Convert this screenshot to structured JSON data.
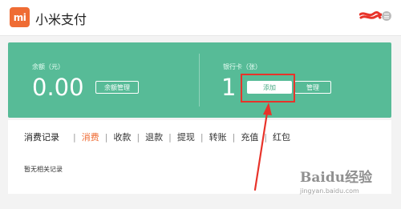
{
  "header": {
    "logo_text": "mi",
    "title": "小米支付",
    "brand_color": "#ef6c34"
  },
  "balance": {
    "label": "余额（元）",
    "amount": "0.00",
    "manage_button": "余额管理"
  },
  "bank_card": {
    "label": "银行卡（张）",
    "count": "1",
    "add_button": "添加",
    "manage_button": "管理"
  },
  "records": {
    "title": "消费记录",
    "tabs": [
      "消费",
      "收款",
      "退款",
      "提现",
      "转账",
      "充值",
      "红包"
    ],
    "active_tab": "消费",
    "empty_message": "暂无相关记录"
  },
  "panel_color": "#57bb97",
  "annotation_color": "#e8332a",
  "watermark": {
    "brand": "Baidu经验",
    "url": "jingyan.baidu.com"
  }
}
